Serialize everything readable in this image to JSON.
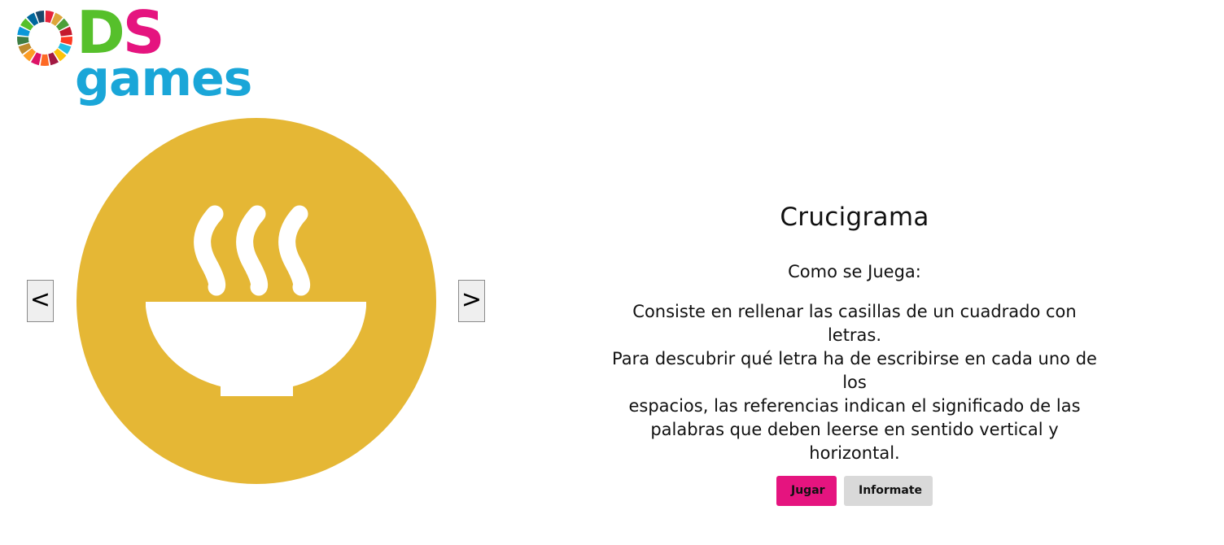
{
  "logo": {
    "line1_d": "D",
    "line1_s": "S",
    "line2": "games",
    "wheel_colors": [
      "#e5243b",
      "#dda63a",
      "#4c9f38",
      "#c5192d",
      "#ff3a21",
      "#26bde2",
      "#fcc30b",
      "#a21942",
      "#fd6925",
      "#dd1367",
      "#fd9d24",
      "#bf8b2e",
      "#3f7e44",
      "#0a97d9",
      "#56c02b",
      "#00689d",
      "#19486a"
    ],
    "d_color": "#56c02b",
    "s_color": "#e5147f",
    "games_color": "#1aa6d8"
  },
  "carousel": {
    "prev_label": "<",
    "next_label": ">",
    "goal_color": "#e5b735",
    "goal_icon": "steaming-bowl-icon"
  },
  "game": {
    "title": "Crucigrama",
    "how_to_label": "Como se Juega:",
    "description_lines": [
      "Consiste en rellenar las casillas de un cuadrado con letras.",
      "Para descubrir qué letra ha de escribirse en cada uno de los",
      "espacios, las referencias indican el significado de las",
      "palabras que deben leerse en sentido vertical y horizontal."
    ]
  },
  "actions": {
    "play_label": "Jugar",
    "info_label": "Informate",
    "play_color": "#e5147f",
    "info_color": "#d9d9d9"
  }
}
